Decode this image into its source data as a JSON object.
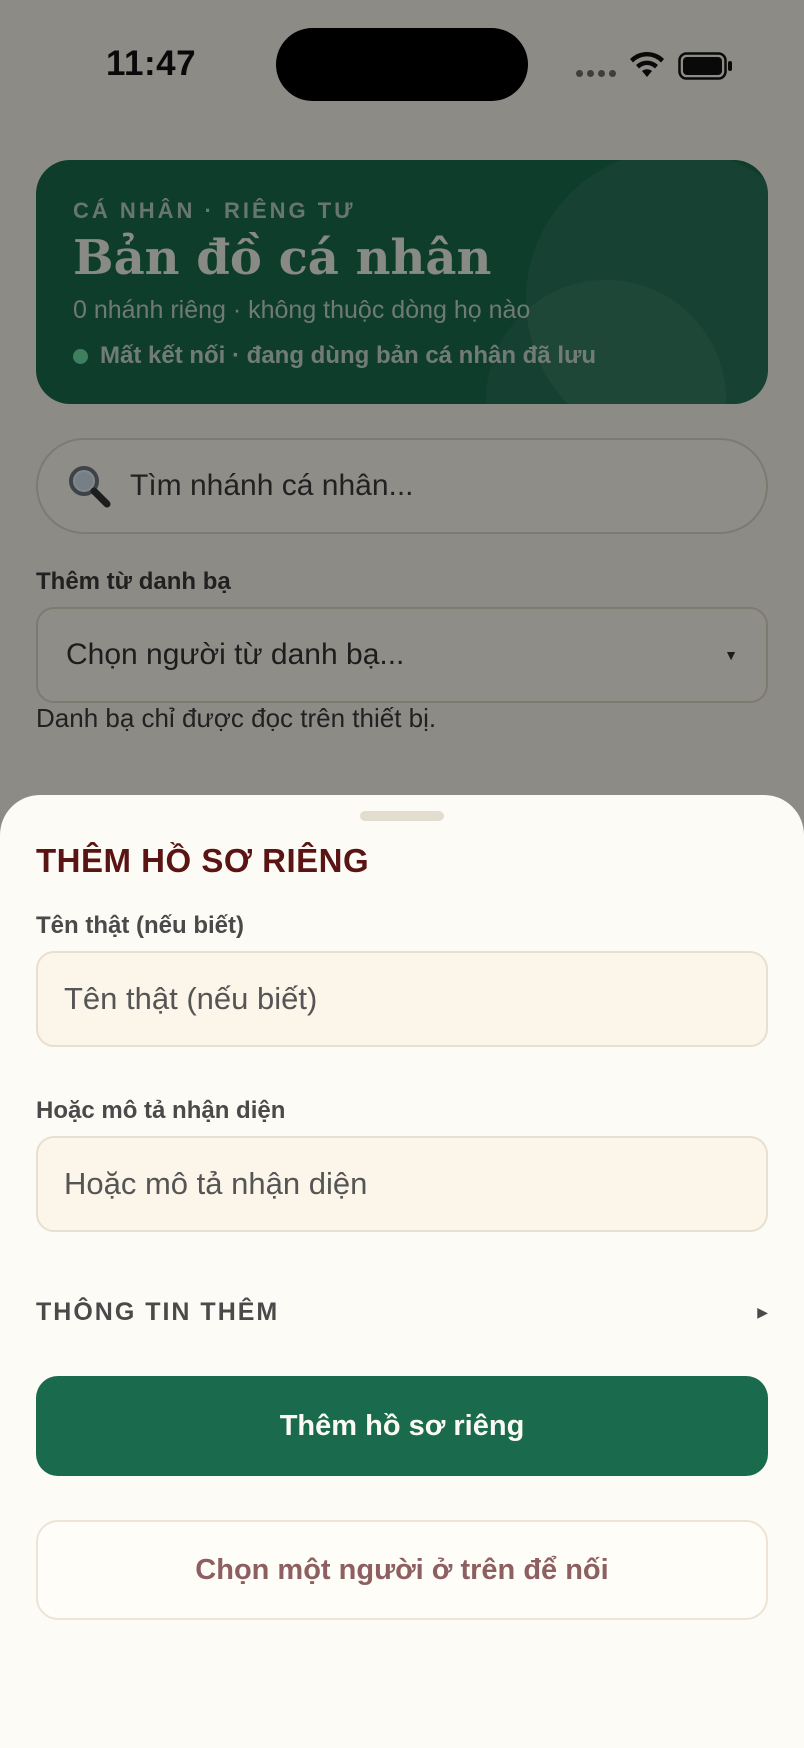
{
  "status_bar": {
    "time": "11:47",
    "wifi_icon": "wifi-icon",
    "battery_icon": "battery-icon"
  },
  "hero": {
    "eyebrow": "CÁ NHÂN · RIÊNG TƯ",
    "title": "Bản đồ cá nhân",
    "subtitle": "0 nhánh riêng · không thuộc dòng họ nào",
    "status_text": "Mất kết nối · đang dùng bản cá nhân đã lưu",
    "status_color": "#6ee0a8",
    "accent": "#1a6b4e"
  },
  "search": {
    "placeholder": "Tìm nhánh cá nhân...",
    "icon": "search-icon"
  },
  "contacts": {
    "label": "Thêm từ danh bạ",
    "select_value": "Chọn người từ danh bạ...",
    "hint": "Danh bạ chỉ được đọc trên thiết bị."
  },
  "sheet": {
    "title": "THÊM HỒ SƠ RIÊNG",
    "real_name_label": "Tên thật (nếu biết)",
    "real_name_placeholder": "Tên thật (nếu biết)",
    "description_label": "Hoặc mô tả nhận diện",
    "description_placeholder": "Hoặc mô tả nhận diện",
    "more_info_label": "THÔNG TIN THÊM",
    "add_button": "Thêm hồ sơ riêng",
    "link_button": "Chọn một người ở trên để nối",
    "title_color": "#5a1414"
  }
}
